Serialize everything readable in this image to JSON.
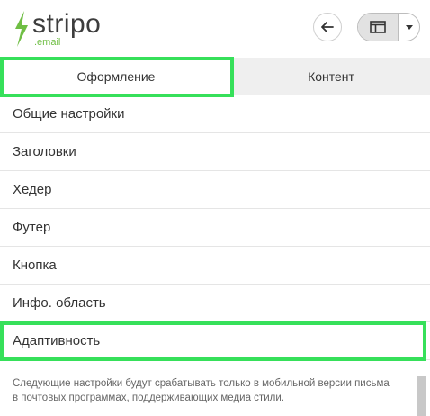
{
  "header": {
    "logo_text": "stripo",
    "logo_sub": ".email",
    "back_icon": "arrow-left-icon",
    "layout_icon": "panel-layout-icon",
    "caret_icon": "chevron-down-icon"
  },
  "tabs": [
    {
      "label": "Оформление",
      "active": true
    },
    {
      "label": "Контент",
      "active": false
    }
  ],
  "menu": {
    "items": [
      {
        "label": "Общие настройки"
      },
      {
        "label": "Заголовки"
      },
      {
        "label": "Хедер"
      },
      {
        "label": "Футер"
      },
      {
        "label": "Кнопка"
      },
      {
        "label": "Инфо. область"
      },
      {
        "label": "Адаптивность"
      }
    ]
  },
  "description": {
    "line1": "Следующие настройки будут срабатывать только в мобильной версии письма",
    "line2": "в почтовых программах, поддерживающих медиа стили."
  },
  "colors": {
    "brand_green": "#6fbe44",
    "highlight_green": "#36e05a",
    "text": "#333333"
  }
}
